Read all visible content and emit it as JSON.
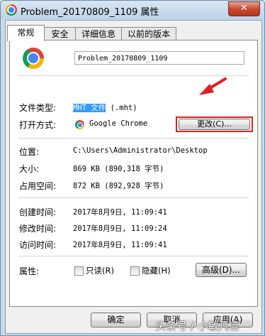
{
  "window": {
    "title": "Problem_20170809_1109 属性",
    "close_symbol": "✕"
  },
  "tabs": [
    {
      "label": "常规"
    },
    {
      "label": "安全"
    },
    {
      "label": "详细信息"
    },
    {
      "label": "以前的版本"
    }
  ],
  "general": {
    "file_name": "Problem_20170809_1109",
    "file_type_label": "文件类型:",
    "file_type_value_highlight": "MHT 文件",
    "file_type_value_ext": " (.mht)",
    "open_with_label": "打开方式:",
    "open_with_app": "Google Chrome",
    "change_button": "更改(C)...",
    "location_label": "位置:",
    "location_value": "C:\\Users\\Administrator\\Desktop",
    "size_label": "大小:",
    "size_value": "869 KB (890,318 字节)",
    "disk_size_label": "占用空间:",
    "disk_size_value": "872 KB (892,928 字节)",
    "created_label": "创建时间:",
    "created_value": "2017年8月9日, 11:09:41",
    "modified_label": "修改时间:",
    "modified_value": "2017年8月9日, 11:09:24",
    "accessed_label": "访问时间:",
    "accessed_value": "2017年8月9日, 11:09:41",
    "attributes_label": "属性:",
    "readonly_label": "只读(R)",
    "hidden_label": "隐藏(H)",
    "advanced_button": "高级(D)..."
  },
  "footer": {
    "ok": "确定",
    "cancel": "取消",
    "apply": "应用(A)"
  },
  "watermark": "头条号 / 小敏凡言",
  "colors": {
    "highlight": "#3399ff",
    "annotation": "#e02020"
  }
}
